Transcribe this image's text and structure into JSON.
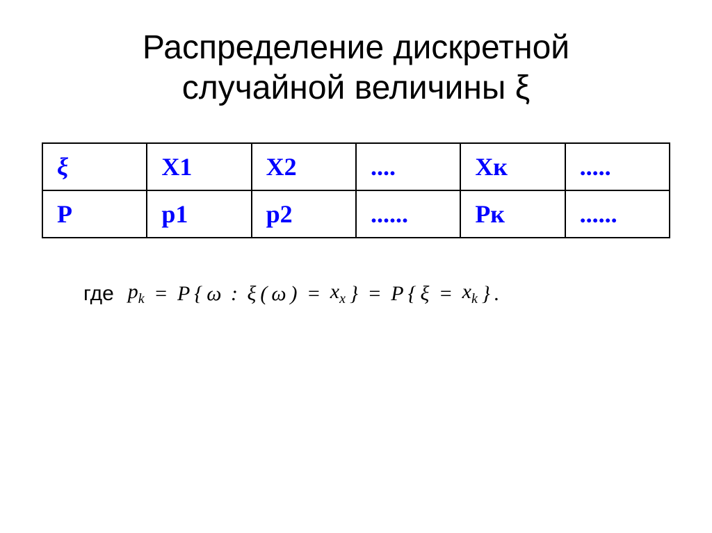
{
  "title": {
    "line1": "Распределение дискретной",
    "line2": "случайной величины ξ"
  },
  "table": {
    "rows": [
      {
        "cells": [
          "ξ",
          "X1",
          "X2",
          "....",
          "Xк",
          "....."
        ]
      },
      {
        "cells": [
          "P",
          "p1",
          "p2",
          "......",
          "Pк",
          "......"
        ]
      }
    ]
  },
  "formula": {
    "where": "где",
    "expression": "p_k = P{ω : ξ(ω) = x_x} = P{ξ = x_k}."
  }
}
